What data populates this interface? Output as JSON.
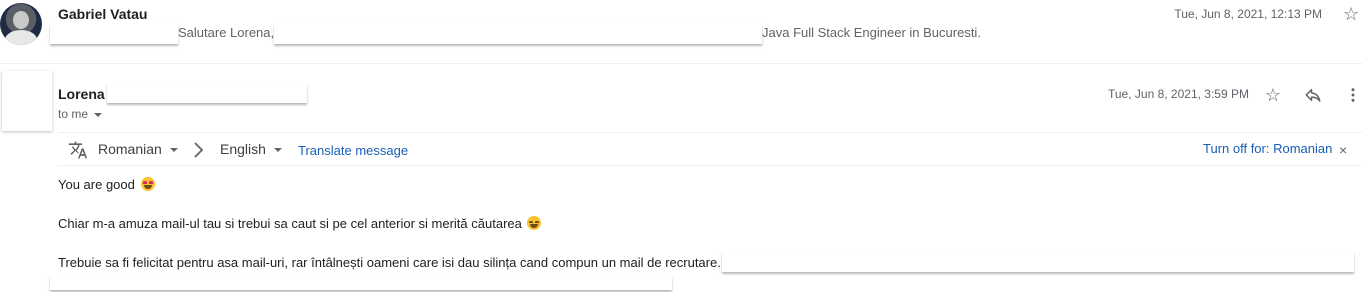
{
  "first_message": {
    "sender": "Gabriel Vatau",
    "snippet_greeting": "Salutare Lorena,",
    "snippet_role": "Java Full Stack Engineer in Bucuresti.",
    "date": "Tue, Jun 8, 2021, 12:13 PM",
    "icons": {
      "avatar": "profile-photo",
      "star": "star-outline-icon"
    }
  },
  "second_message": {
    "sender": "Lorena",
    "recipient": "to me",
    "date": "Tue, Jun 8, 2021, 3:59 PM",
    "icons": {
      "star": "star-outline-icon",
      "reply": "reply-icon",
      "more": "more-vertical-icon"
    }
  },
  "translate_bar": {
    "from_language": "Romanian",
    "to_language": "English",
    "translate_link": "Translate message",
    "turn_off": "Turn off for: Romanian",
    "close": "×",
    "icons": {
      "translate": "translate-icon",
      "arrow": "chevron-right-icon"
    }
  },
  "body": {
    "line1": "You are good",
    "line2": "Chiar m-a amuza mail-ul tau si trebui sa caut si pe cel anterior si merită căutarea",
    "line3": "Trebuie sa fi felicitat pentru asa mail-uri, rar întâlnești oameni care isi dau silința cand compun un mail de recrutare."
  }
}
